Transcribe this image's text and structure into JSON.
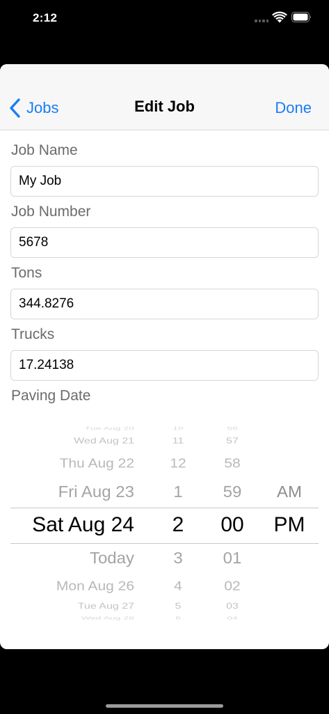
{
  "status_bar": {
    "time": "2:12"
  },
  "nav": {
    "back_label": "Jobs",
    "title": "Edit Job",
    "done_label": "Done"
  },
  "fields": [
    {
      "label": "Job Name",
      "value": "My Job"
    },
    {
      "label": "Job Number",
      "value": "5678"
    },
    {
      "label": "Tons",
      "value": "344.8276"
    },
    {
      "label": "Trucks",
      "value": "17.24138"
    }
  ],
  "paving_date": {
    "label": "Paving Date",
    "picker": {
      "selected_index": 4,
      "rows": [
        {
          "date": "Tue Aug 20",
          "hour": "10",
          "minute": "56",
          "ampm": ""
        },
        {
          "date": "Wed Aug 21",
          "hour": "11",
          "minute": "57",
          "ampm": ""
        },
        {
          "date": "Thu Aug 22",
          "hour": "12",
          "minute": "58",
          "ampm": ""
        },
        {
          "date": "Fri Aug 23",
          "hour": "1",
          "minute": "59",
          "ampm": "AM"
        },
        {
          "date": "Sat Aug 24",
          "hour": "2",
          "minute": "00",
          "ampm": "PM"
        },
        {
          "date": "Today",
          "hour": "3",
          "minute": "01",
          "ampm": ""
        },
        {
          "date": "Mon Aug 26",
          "hour": "4",
          "minute": "02",
          "ampm": ""
        },
        {
          "date": "Tue Aug 27",
          "hour": "5",
          "minute": "03",
          "ampm": ""
        },
        {
          "date": "Wed Aug 28",
          "hour": "6",
          "minute": "04",
          "ampm": ""
        }
      ]
    }
  },
  "colors": {
    "accent": "#1a7cf5",
    "label_gray": "#6b6b6b",
    "picker_dim": "#b8b8b8"
  }
}
